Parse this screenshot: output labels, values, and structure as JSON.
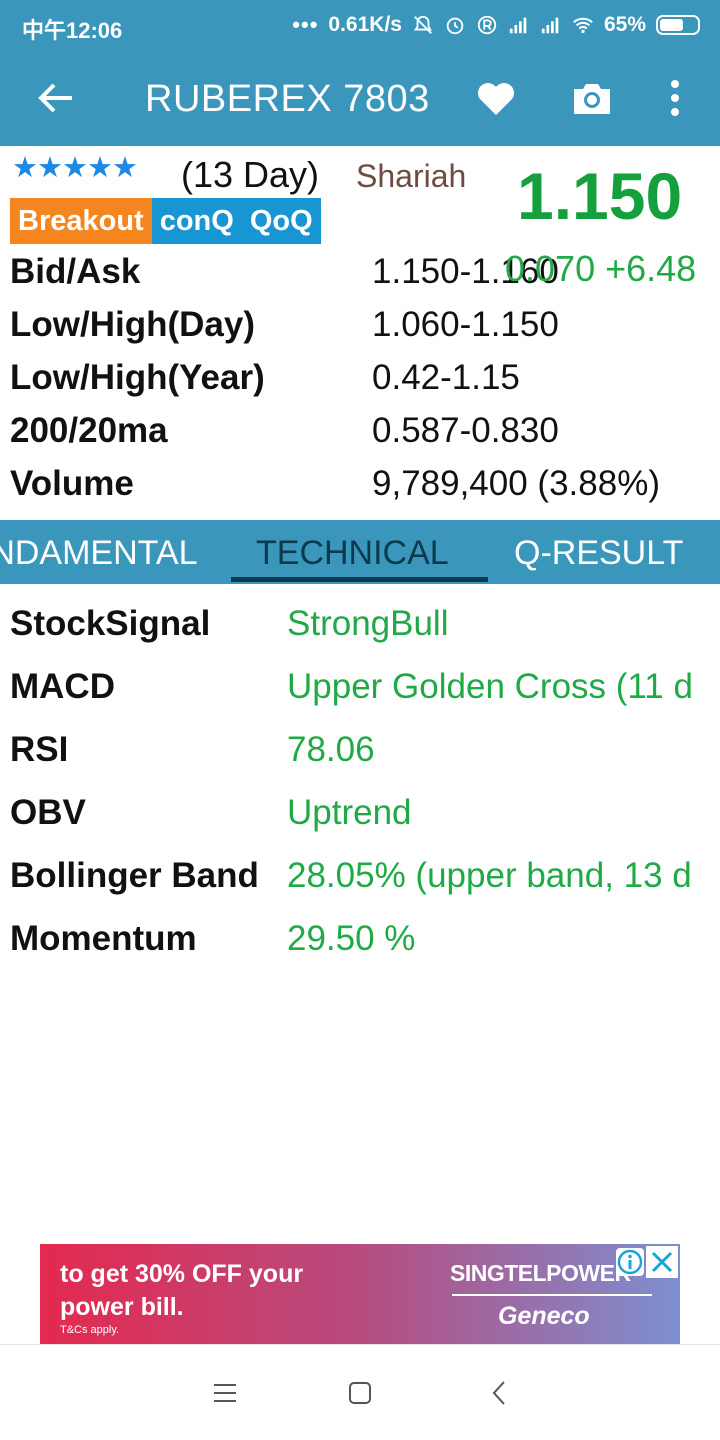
{
  "status_bar": {
    "time": "中午12:06",
    "dots": "•••",
    "network_speed": "0.61K/s",
    "battery": "65%",
    "battery_level": 0.65
  },
  "app_bar": {
    "title": "RUBEREX 7803"
  },
  "summary": {
    "stars": "★★★★★",
    "rating": 5,
    "days": "(13 Day)",
    "shariah": "Shariah",
    "price": "1.150",
    "change": "0.070 +6.48",
    "tags": [
      "Breakout",
      "conQ",
      "QoQ"
    ]
  },
  "quote": {
    "rows": [
      {
        "label": "Bid/Ask",
        "value": "1.150-1.160"
      },
      {
        "label": "Low/High(Day)",
        "value": "1.060-1.150"
      },
      {
        "label": "Low/High(Year)",
        "value": "0.42-1.15"
      },
      {
        "label": "200/20ma",
        "value": "0.587-0.830"
      },
      {
        "label": "Volume",
        "value": "9,789,400 (3.88%)"
      }
    ]
  },
  "tabs": [
    "FUNDAMENTAL",
    "TECHNICAL",
    "Q-RESULT"
  ],
  "active_tab": "TECHNICAL",
  "technical": {
    "rows": [
      {
        "label": "StockSignal",
        "value": "StrongBull"
      },
      {
        "label": "MACD",
        "value": "Upper Golden Cross (11 d"
      },
      {
        "label": "RSI",
        "value": "78.06"
      },
      {
        "label": "OBV",
        "value": "Uptrend"
      },
      {
        "label": "Bollinger Band",
        "value": "28.05% (upper band, 13 d"
      },
      {
        "label": "Momentum",
        "value": "29.50 %"
      }
    ]
  },
  "ad": {
    "line1": "to get 30% OFF your",
    "line2": "power bill.",
    "tc": "T&Cs apply.",
    "brand1": "SINGTELPOWER",
    "brand2": "Geneco"
  },
  "colors": {
    "header": "#3a97bb",
    "price_green": "#14a03c",
    "value_green": "#1faa45",
    "star_blue": "#1e88e5",
    "tag_orange": "#f5861f",
    "tag_blue": "#1896d3",
    "shariah_brown": "#6d4c41"
  }
}
